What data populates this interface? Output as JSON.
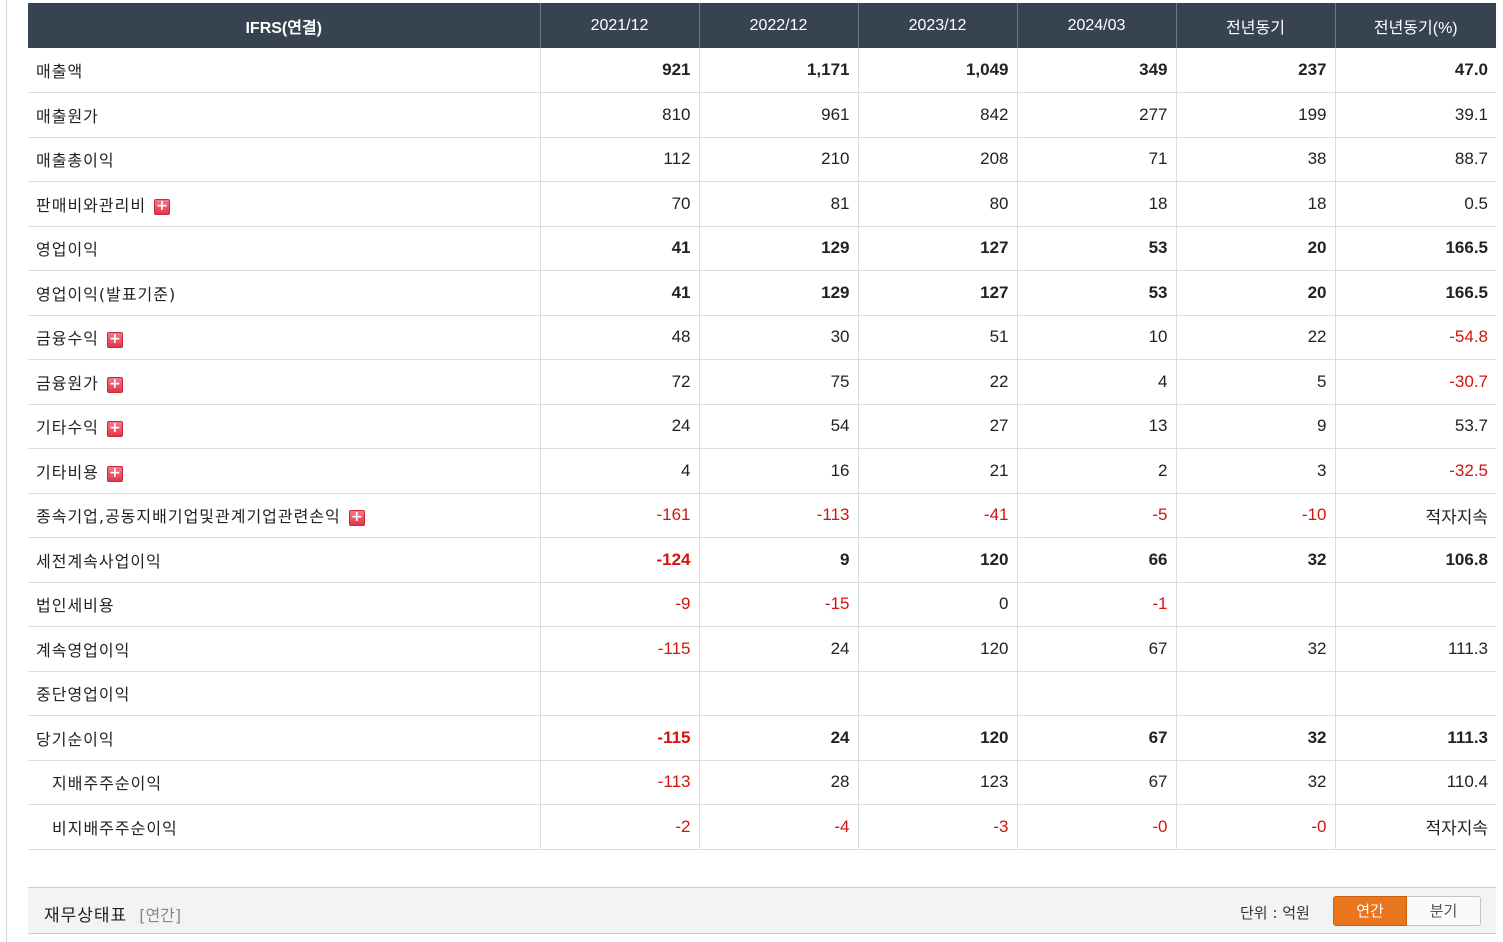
{
  "header": {
    "label": "IFRS(연결)",
    "columns": [
      "2021/12",
      "2022/12",
      "2023/12",
      "2024/03",
      "전년동기",
      "전년동기(%)"
    ]
  },
  "rows": [
    {
      "label": "매출액",
      "expand": false,
      "bold": true,
      "sub": false,
      "values": [
        "921",
        "1,171",
        "1,049",
        "349",
        "237",
        "47.0"
      ]
    },
    {
      "label": "매출원가",
      "expand": false,
      "bold": false,
      "sub": false,
      "values": [
        "810",
        "961",
        "842",
        "277",
        "199",
        "39.1"
      ]
    },
    {
      "label": "매출총이익",
      "expand": false,
      "bold": false,
      "sub": false,
      "values": [
        "112",
        "210",
        "208",
        "71",
        "38",
        "88.7"
      ]
    },
    {
      "label": "판매비와관리비",
      "expand": true,
      "bold": false,
      "sub": false,
      "values": [
        "70",
        "81",
        "80",
        "18",
        "18",
        "0.5"
      ]
    },
    {
      "label": "영업이익",
      "expand": false,
      "bold": true,
      "sub": false,
      "values": [
        "41",
        "129",
        "127",
        "53",
        "20",
        "166.5"
      ]
    },
    {
      "label": "영업이익(발표기준)",
      "expand": false,
      "bold": true,
      "sub": false,
      "values": [
        "41",
        "129",
        "127",
        "53",
        "20",
        "166.5"
      ]
    },
    {
      "label": "금융수익",
      "expand": true,
      "bold": false,
      "sub": false,
      "values": [
        "48",
        "30",
        "51",
        "10",
        "22",
        "-54.8"
      ]
    },
    {
      "label": "금융원가",
      "expand": true,
      "bold": false,
      "sub": false,
      "values": [
        "72",
        "75",
        "22",
        "4",
        "5",
        "-30.7"
      ]
    },
    {
      "label": "기타수익",
      "expand": true,
      "bold": false,
      "sub": false,
      "values": [
        "24",
        "54",
        "27",
        "13",
        "9",
        "53.7"
      ]
    },
    {
      "label": "기타비용",
      "expand": true,
      "bold": false,
      "sub": false,
      "values": [
        "4",
        "16",
        "21",
        "2",
        "3",
        "-32.5"
      ]
    },
    {
      "label": "종속기업,공동지배기업및관계기업관련손익",
      "expand": true,
      "bold": false,
      "sub": false,
      "values": [
        "-161",
        "-113",
        "-41",
        "-5",
        "-10",
        "적자지속"
      ]
    },
    {
      "label": "세전계속사업이익",
      "expand": false,
      "bold": true,
      "sub": false,
      "values": [
        "-124",
        "9",
        "120",
        "66",
        "32",
        "106.8"
      ]
    },
    {
      "label": "법인세비용",
      "expand": false,
      "bold": false,
      "sub": false,
      "values": [
        "-9",
        "-15",
        "0",
        "-1",
        "",
        ""
      ]
    },
    {
      "label": "계속영업이익",
      "expand": false,
      "bold": false,
      "sub": false,
      "values": [
        "-115",
        "24",
        "120",
        "67",
        "32",
        "111.3"
      ]
    },
    {
      "label": "중단영업이익",
      "expand": false,
      "bold": false,
      "sub": false,
      "values": [
        "",
        "",
        "",
        "",
        "",
        ""
      ]
    },
    {
      "label": "당기순이익",
      "expand": false,
      "bold": true,
      "sub": false,
      "values": [
        "-115",
        "24",
        "120",
        "67",
        "32",
        "111.3"
      ]
    },
    {
      "label": "지배주주순이익",
      "expand": false,
      "bold": false,
      "sub": true,
      "values": [
        "-113",
        "28",
        "123",
        "67",
        "32",
        "110.4"
      ]
    },
    {
      "label": "비지배주주순이익",
      "expand": false,
      "bold": false,
      "sub": true,
      "values": [
        "-2",
        "-4",
        "-3",
        "-0",
        "-0",
        "적자지속"
      ]
    }
  ],
  "expand_icon": "plus-square-icon",
  "colors": {
    "header_bg": "#374351",
    "negative": "#d2140d",
    "active_tab": "#e9751c"
  },
  "footer": {
    "title": "재무상태표",
    "subtitle": "[연간]",
    "unit": "단위 : 억원",
    "tabs": [
      "연간",
      "분기"
    ],
    "active_tab": "연간"
  }
}
